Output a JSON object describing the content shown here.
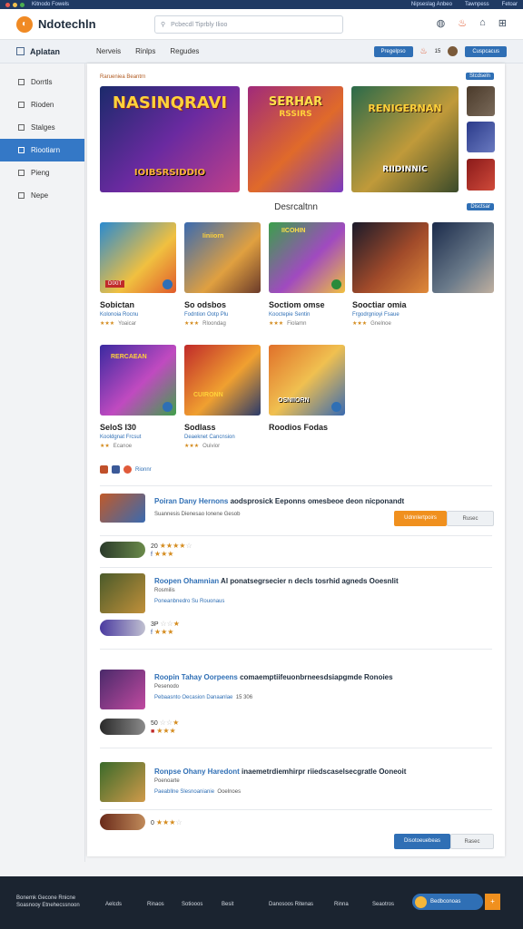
{
  "system_bar": {
    "left_text": "Kitnodo Fowels",
    "right_items": [
      "Nipseslag Anbeo",
      "Tawnpess",
      "Fetoar"
    ]
  },
  "header": {
    "brand": "Ndotechln",
    "search_placeholder": "Pcbecdl Tiprbly Ilioo"
  },
  "subbar": {
    "app_name": "Aplatan",
    "nav": [
      "Nerveis",
      "Rinlps",
      "Regudes"
    ],
    "action_label": "Pregelpso",
    "count": "15",
    "user_label": "Cuspcacus"
  },
  "sidebar": {
    "items": [
      {
        "label": "Dorrtls",
        "active": false
      },
      {
        "label": "Rioden",
        "active": false
      },
      {
        "label": "Stalges",
        "active": false
      },
      {
        "label": "Riootiarn",
        "active": true
      },
      {
        "label": "Pieng",
        "active": false
      },
      {
        "label": "Nepe",
        "active": false
      }
    ]
  },
  "featured": {
    "tag": "Rarueniea Beantrn",
    "tag_right": "Stcdseln",
    "banners": [
      {
        "title": "NASINQRAVI",
        "subtitle": "IOIBSRSIDDIO"
      },
      {
        "title": "SERHAR",
        "subtitle": "RSSIRS"
      },
      {
        "title": "RENIGERNAN",
        "subtitle": "RIIDINNIC"
      }
    ]
  },
  "section": {
    "title": "Desrcaltnn",
    "tag": "Disctsar"
  },
  "games": [
    {
      "name": "Sobictan",
      "meta": "Kolonoia Rocnu",
      "reviews": "Yoaicar",
      "label": "DIXIT"
    },
    {
      "name": "So odsbos",
      "meta": "Fodntion Ootp Plu",
      "reviews": "Rloondag",
      "label": "Iiniiorn"
    },
    {
      "name": "Soctiom omse",
      "meta": "Kooctepie Sentin",
      "reviews": "Fiolamn",
      "label": "IICOHIN"
    },
    {
      "name": "Sooctiar omia",
      "meta": "Frgodrgnioyi Fsaue",
      "reviews": "Gnelnoe",
      "label": ""
    },
    {
      "name": "",
      "meta": "",
      "reviews": "",
      "label": ""
    },
    {
      "name": "SeloS I30",
      "meta": "Kooldgnat Frcsut",
      "reviews": "Ecanoe",
      "label": "RERCAEAN"
    },
    {
      "name": "Sodlass",
      "meta": "Deaeknet Cancnsion",
      "reviews": "Ouivior",
      "label": "CUIRONN"
    },
    {
      "name": "Roodios Fodas",
      "meta": "",
      "reviews": "",
      "label": "OSNIIORN"
    }
  ],
  "social": {
    "label": "Rionnr"
  },
  "list": [
    {
      "title_a": "Poiran Dany Hernons",
      "title_b": " aodsprosick Eeponns omesbeoe deon nicponandt",
      "sub": "Suannesis Dienesao Ionene Gesob",
      "rating_num": "20",
      "button": "Udnnlertpoirs",
      "button2": "Rusec"
    },
    {
      "title_a": "Roopen Ohamnian",
      "title_b": " Al ponatsegrsecier n decls tosrhid agneds Ooesnlit",
      "sub": "Rosmilis",
      "sub2": "Poneanbnedro Su Rouonaus",
      "rating_num": "3P"
    },
    {
      "title_a": "Roopin Tahay Oorpeens",
      "title_b": " comaemptiifeuonbrneesdsiapgmde Ronoies",
      "sub": "Pesenodo",
      "sub2": "Pebaasnto Oecasion Danaanlae",
      "extra": "15 306",
      "rating_num": "50"
    },
    {
      "title_a": "Ronpse Ohany Haredont",
      "title_b": " inaemetrdiemhirpr riiedscaselsecgratle Ooneoit",
      "sub": "Poenoarte",
      "sub2": "Paeabllne Slesnoanianie",
      "extra": "Ooelnoes",
      "rating_num": "0"
    }
  ],
  "bottom_buttons": {
    "primary": "Disotoeuebeas",
    "secondary": "Rasec"
  },
  "footer": {
    "left": "Bonemk Gecone Rnicne",
    "left2": "Soasnooy Etnehecssnoon",
    "cols": [
      "Aelcds",
      "Rinaos",
      "Sotiooos",
      "Besit",
      "Danosoos Ritenas",
      "Rinna",
      "Seaotros"
    ],
    "pill": "Bedbconoas"
  },
  "colors": {
    "accent": "#2f6fb5",
    "orange": "#f0901e",
    "sidebar_active": "#3478c6",
    "footer": "#1b2430"
  }
}
